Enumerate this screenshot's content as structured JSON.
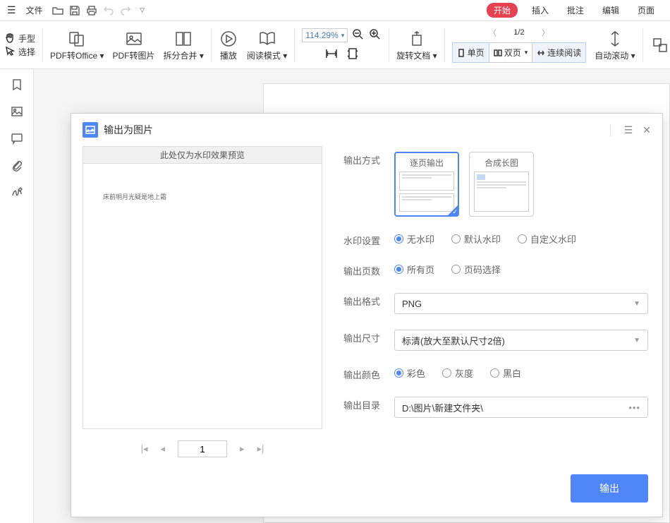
{
  "menubar": {
    "file": "文件",
    "tabs": {
      "start": "开始",
      "insert": "插入",
      "annotate": "批注",
      "edit": "编辑",
      "page": "页面"
    }
  },
  "ribbon": {
    "hand": "手型",
    "select": "选择",
    "pdf_to_office": "PDF转Office",
    "pdf_to_image": "PDF转图片",
    "split_merge": "拆分合并",
    "play": "播放",
    "read_mode": "阅读模式",
    "zoom": "114.29%",
    "rotate": "旋转文档",
    "page_nav": "1/2",
    "single": "单页",
    "double": "双页",
    "continuous": "连续阅读",
    "auto_scroll": "自动滚动"
  },
  "dialog": {
    "title": "输出为图片",
    "preview_hint": "此处仅为水印效果预览",
    "preview_doc_text": "床前明月光疑是地上霜",
    "pager_current": "1",
    "labels": {
      "output_mode": "输出方式",
      "watermark": "水印设置",
      "pages": "输出页数",
      "format": "输出格式",
      "size": "输出尺寸",
      "color": "输出颜色",
      "dir": "输出目录"
    },
    "mode": {
      "per_page": "逐页输出",
      "long_image": "合成长图"
    },
    "watermark": {
      "none": "无水印",
      "default": "默认水印",
      "custom": "自定义水印"
    },
    "pages": {
      "all": "所有页",
      "select": "页码选择"
    },
    "format_value": "PNG",
    "size_value": "标清(放大至默认尺寸2倍)",
    "color": {
      "color": "彩色",
      "gray": "灰度",
      "bw": "黑白"
    },
    "dir_value": "D:\\图片\\新建文件夹\\",
    "export_btn": "输出"
  }
}
